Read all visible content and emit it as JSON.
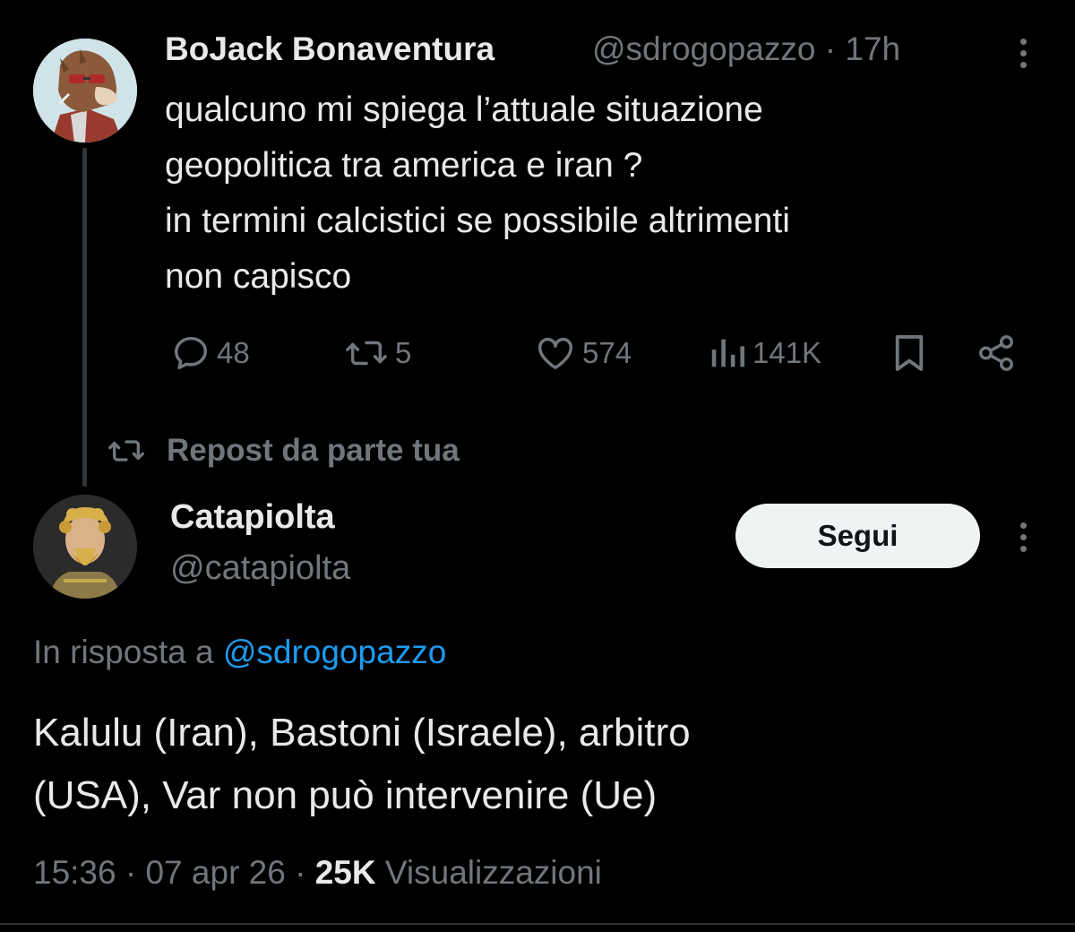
{
  "parent_tweet": {
    "author_name": "BoJack Bonaventura",
    "handle": "@sdrogopazzo",
    "separator": "·",
    "time": "17h",
    "text_lines": [
      "qualcuno mi spiega l’attuale situazione",
      "geopolitica tra america e iran ?",
      "in termini calcistici se possibile altrimenti",
      "non capisco"
    ],
    "actions": {
      "reply_count": "48",
      "repost_count": "5",
      "like_count": "574",
      "views_count": "141K"
    },
    "icons": [
      "avatar-bojack",
      "reply-icon",
      "repost-icon",
      "like-icon",
      "views-icon",
      "bookmark-icon",
      "share-icon",
      "more-icon"
    ]
  },
  "repost_indicator": {
    "label": "Repost da parte tua",
    "icon": "repost-icon"
  },
  "main_tweet": {
    "author_name": "Catapiolta",
    "handle": "@catapiolta",
    "follow_label": "Segui",
    "reply_prefix": "In risposta a",
    "reply_to_handle": "@sdrogopazzo",
    "text_lines": [
      "Kalulu (Iran), Bastoni (Israele), arbitro",
      "(USA), Var non può intervenire (Ue)"
    ],
    "meta": {
      "time": "15:36",
      "separator": "·",
      "date": "07 apr 26",
      "views_count": "25K",
      "views_label": "Visualizzazioni"
    }
  },
  "colors": {
    "background": "#000000",
    "text_primary": "#e7e9ea",
    "text_secondary": "#71767b",
    "link": "#1d9bf0",
    "button_bg": "#eff3f4",
    "button_text": "#0f1419"
  }
}
